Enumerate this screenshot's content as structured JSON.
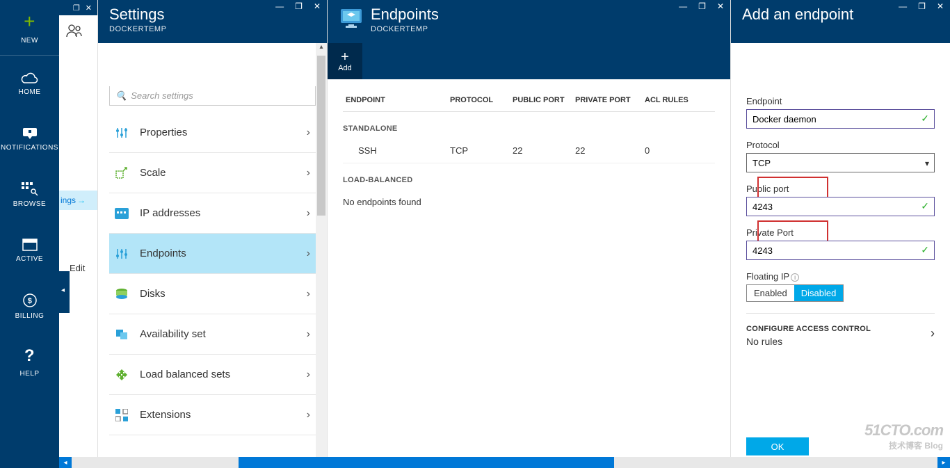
{
  "sidebar": {
    "new": "NEW",
    "home": "HOME",
    "notifications": "NOTIFICATIONS",
    "browse": "BROWSE",
    "active": "ACTIVE",
    "billing": "BILLING",
    "help": "HELP"
  },
  "partial": {
    "settings_link": "ings",
    "edit": "Edit"
  },
  "settings_blade": {
    "title": "Settings",
    "subtitle": "DOCKERTEMP",
    "search_placeholder": "Search settings",
    "items": [
      {
        "label": "Properties"
      },
      {
        "label": "Scale"
      },
      {
        "label": "IP addresses"
      },
      {
        "label": "Endpoints"
      },
      {
        "label": "Disks"
      },
      {
        "label": "Availability set"
      },
      {
        "label": "Load balanced sets"
      },
      {
        "label": "Extensions"
      }
    ]
  },
  "endpoints_blade": {
    "title": "Endpoints",
    "subtitle": "DOCKERTEMP",
    "add_label": "Add",
    "columns": {
      "endpoint": "ENDPOINT",
      "protocol": "PROTOCOL",
      "public_port": "PUBLIC PORT",
      "private_port": "PRIVATE PORT",
      "acl_rules": "ACL RULES"
    },
    "section_standalone": "STANDALONE",
    "section_loadbalanced": "LOAD-BALANCED",
    "rows": [
      {
        "endpoint": "SSH",
        "protocol": "TCP",
        "public_port": "22",
        "private_port": "22",
        "acl_rules": "0"
      }
    ],
    "empty_text": "No endpoints found"
  },
  "add_blade": {
    "title": "Add an endpoint",
    "endpoint_label": "Endpoint",
    "endpoint_value": "Docker daemon",
    "protocol_label": "Protocol",
    "protocol_value": "TCP",
    "public_port_label": "Public port",
    "public_port_value": "4243",
    "private_port_label": "Private Port",
    "private_port_value": "4243",
    "floating_ip_label": "Floating IP",
    "enabled": "Enabled",
    "disabled": "Disabled",
    "acl_title": "CONFIGURE ACCESS CONTROL",
    "acl_sub": "No rules",
    "ok": "OK"
  },
  "watermark": {
    "line1": "51CTO.com",
    "line2": "技术博客 Blog"
  }
}
